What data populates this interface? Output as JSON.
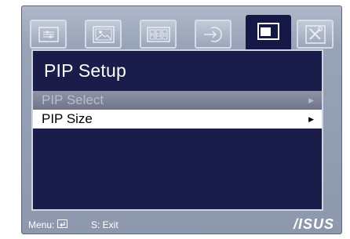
{
  "tabs": [
    {
      "icon": "splendid-icon",
      "active": false
    },
    {
      "icon": "image-icon",
      "active": false
    },
    {
      "icon": "color-icon",
      "active": false
    },
    {
      "icon": "input-select-icon",
      "active": false
    },
    {
      "icon": "pip-icon",
      "active": true
    },
    {
      "icon": "system-setup-icon",
      "active": false
    }
  ],
  "panel": {
    "title": "PIP Setup",
    "items": [
      {
        "label": "PIP Select",
        "state": "disabled",
        "arrow": "▶"
      },
      {
        "label": "PIP Size",
        "state": "selected",
        "arrow": "▶"
      }
    ]
  },
  "footer": {
    "menu_label": "Menu:",
    "exit_label": "S: Exit",
    "logo": "/ISUS"
  },
  "colors": {
    "panel_bg": "#1a1c4a",
    "frame": "#98a3b8",
    "selected_row": "#ffffff",
    "disabled_row": "#7e8398"
  }
}
